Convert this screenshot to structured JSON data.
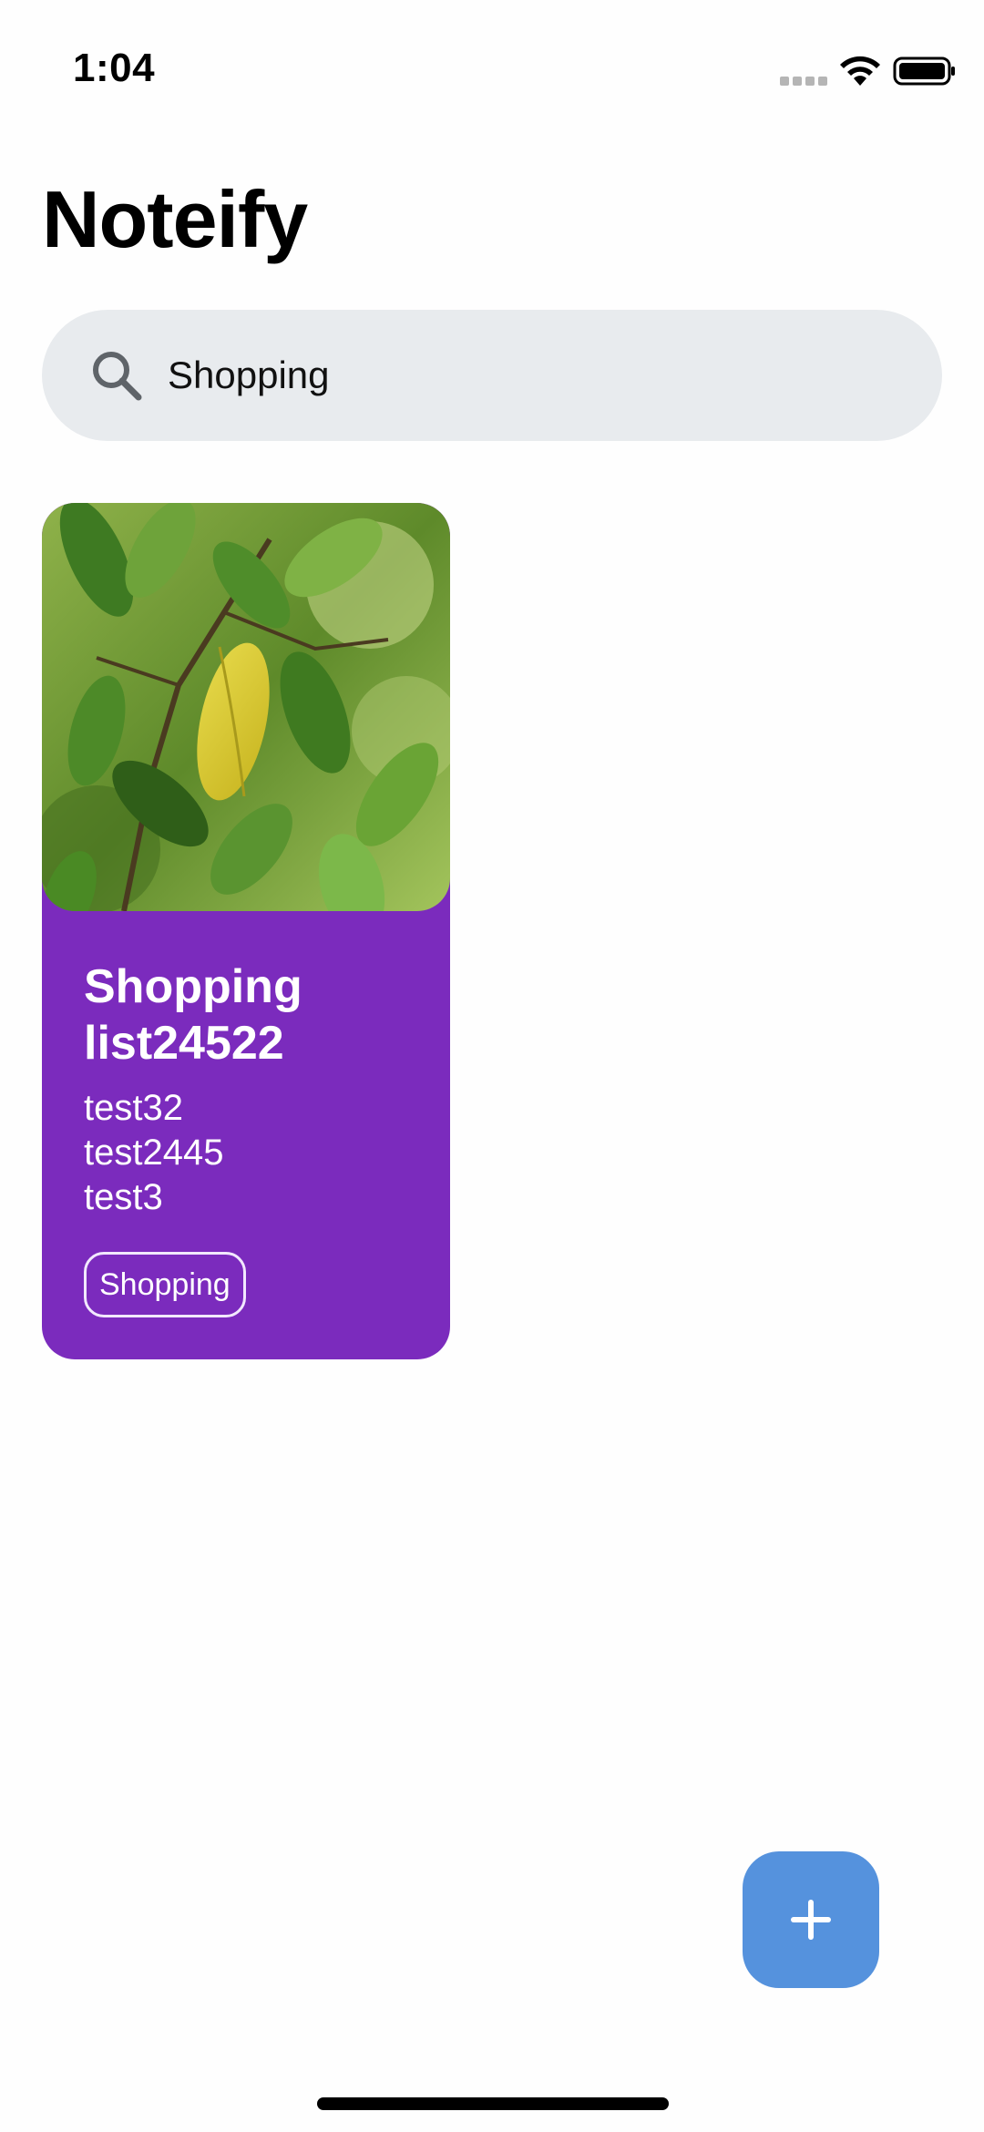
{
  "status_bar": {
    "time": "1:04",
    "icons": [
      "signal-dots-icon",
      "wifi-icon",
      "battery-icon"
    ]
  },
  "app": {
    "title": "Noteify"
  },
  "search": {
    "value": "Shopping",
    "icon": "search-icon"
  },
  "notes": [
    {
      "title": "Shopping list24522",
      "lines": [
        "test32",
        "test2445",
        "test3"
      ],
      "tag": "Shopping",
      "card_color": "#7b2bbd",
      "image": "leafy-plant-photo"
    }
  ],
  "fab": {
    "icon": "plus-icon",
    "color": "#5592dd"
  }
}
